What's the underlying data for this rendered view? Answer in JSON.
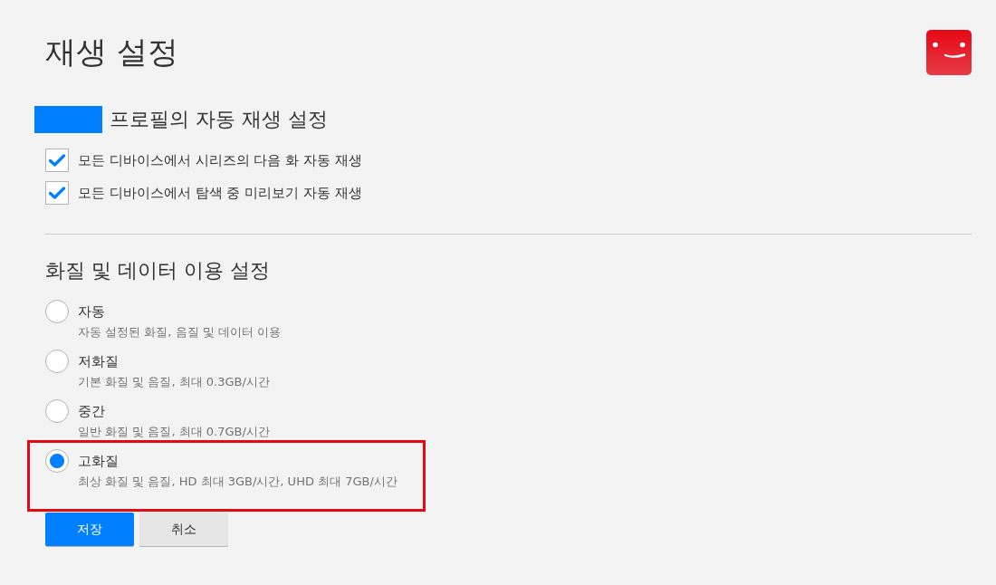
{
  "page": {
    "title": "재생 설정"
  },
  "autoplay": {
    "heading": "프로필의 자동 재생 설정",
    "options": [
      {
        "label": "모든 디바이스에서 시리즈의 다음 화 자동 재생",
        "checked": true
      },
      {
        "label": "모든 디바이스에서 탐색 중 미리보기 자동 재생",
        "checked": true
      }
    ]
  },
  "quality": {
    "heading": "화질 및 데이터 이용 설정",
    "options": [
      {
        "label": "자동",
        "description": "자동 설정된 화질, 음질 및 데이터 이용",
        "selected": false,
        "highlighted": false
      },
      {
        "label": "저화질",
        "description": "기본 화질 및 음질, 최대 0.3GB/시간",
        "selected": false,
        "highlighted": false
      },
      {
        "label": "중간",
        "description": "일반 화질 및 음질, 최대 0.7GB/시간",
        "selected": false,
        "highlighted": false
      },
      {
        "label": "고화질",
        "description": "최상 화질 및 음질, HD 최대 3GB/시간, UHD 최대 7GB/시간",
        "selected": true,
        "highlighted": true
      }
    ]
  },
  "buttons": [
    {
      "label": "저장",
      "kind": "primary"
    },
    {
      "label": "취소",
      "kind": "secondary"
    }
  ]
}
